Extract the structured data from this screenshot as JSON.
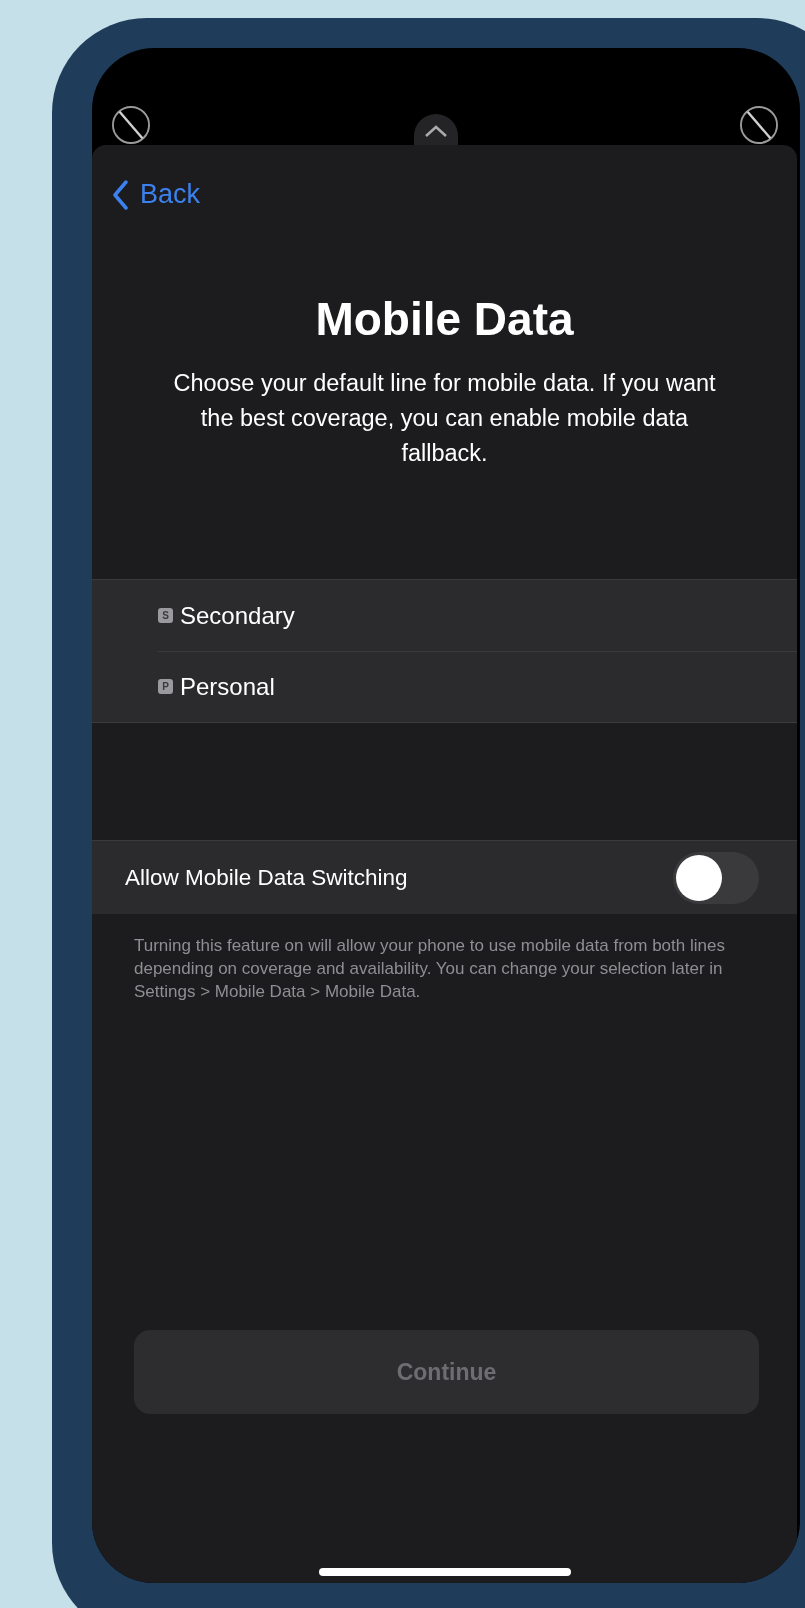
{
  "nav": {
    "back": "Back"
  },
  "title": "Mobile Data",
  "description": "Choose your default line for mobile data. If you want the best coverage, you can enable mobile data fallback.",
  "lines": [
    {
      "badge": "S",
      "label": "Secondary",
      "selected": false
    },
    {
      "badge": "P",
      "label": "Personal",
      "selected": false
    }
  ],
  "switch": {
    "label": "Allow Mobile Data Switching",
    "on": false
  },
  "footnote": "Turning this feature on will allow your phone to use mobile data from both lines depending on coverage and availability. You can change your selection later in Settings > Mobile Data > Mobile Data.",
  "continue": {
    "label": "Continue",
    "disabled": true
  }
}
